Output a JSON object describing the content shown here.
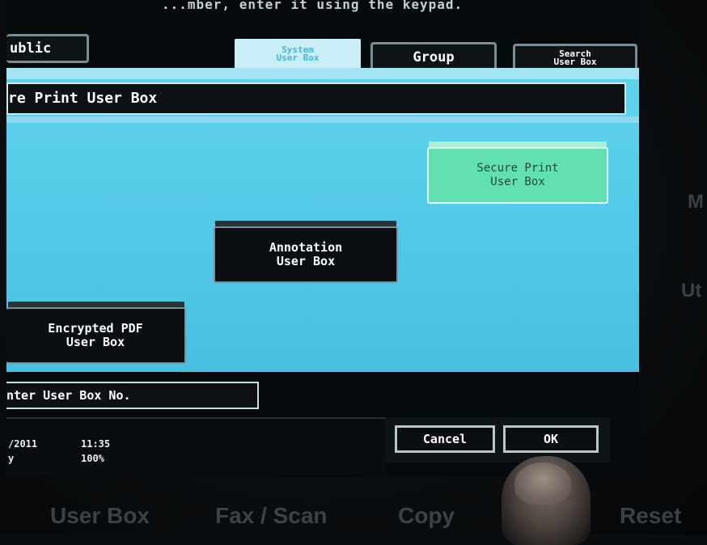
{
  "top_message": "...mber, enter it using the keypad.",
  "tabs": [
    {
      "label": "ublic",
      "active": false
    },
    {
      "label": "System\nUser Box",
      "active": true
    },
    {
      "label": "Group",
      "active": false
    },
    {
      "label": "Search\nUser Box",
      "active": false
    }
  ],
  "title_bar": "re Print User Box",
  "boxes": {
    "secure_print": "Secure Print\nUser Box",
    "annotation": "Annotation\nUser Box",
    "encrypted_pdf": "Encrypted PDF\nUser Box"
  },
  "entry_field": "nter User Box No.",
  "status": {
    "date": "/2011",
    "time": "11:35",
    "memory_label": "y",
    "memory_value": "100%"
  },
  "actions": {
    "cancel": "Cancel",
    "ok": "OK"
  },
  "hardware_keys": [
    "User Box",
    "Fax / Scan",
    "Copy",
    "Reset"
  ],
  "side_labels": [
    "M",
    "Ut"
  ],
  "colors": {
    "panel": "#5fd3ee",
    "active_tab": "#c9eef8",
    "secure_print_box": "#63e0b0",
    "dark_button": "#0b0f12"
  }
}
